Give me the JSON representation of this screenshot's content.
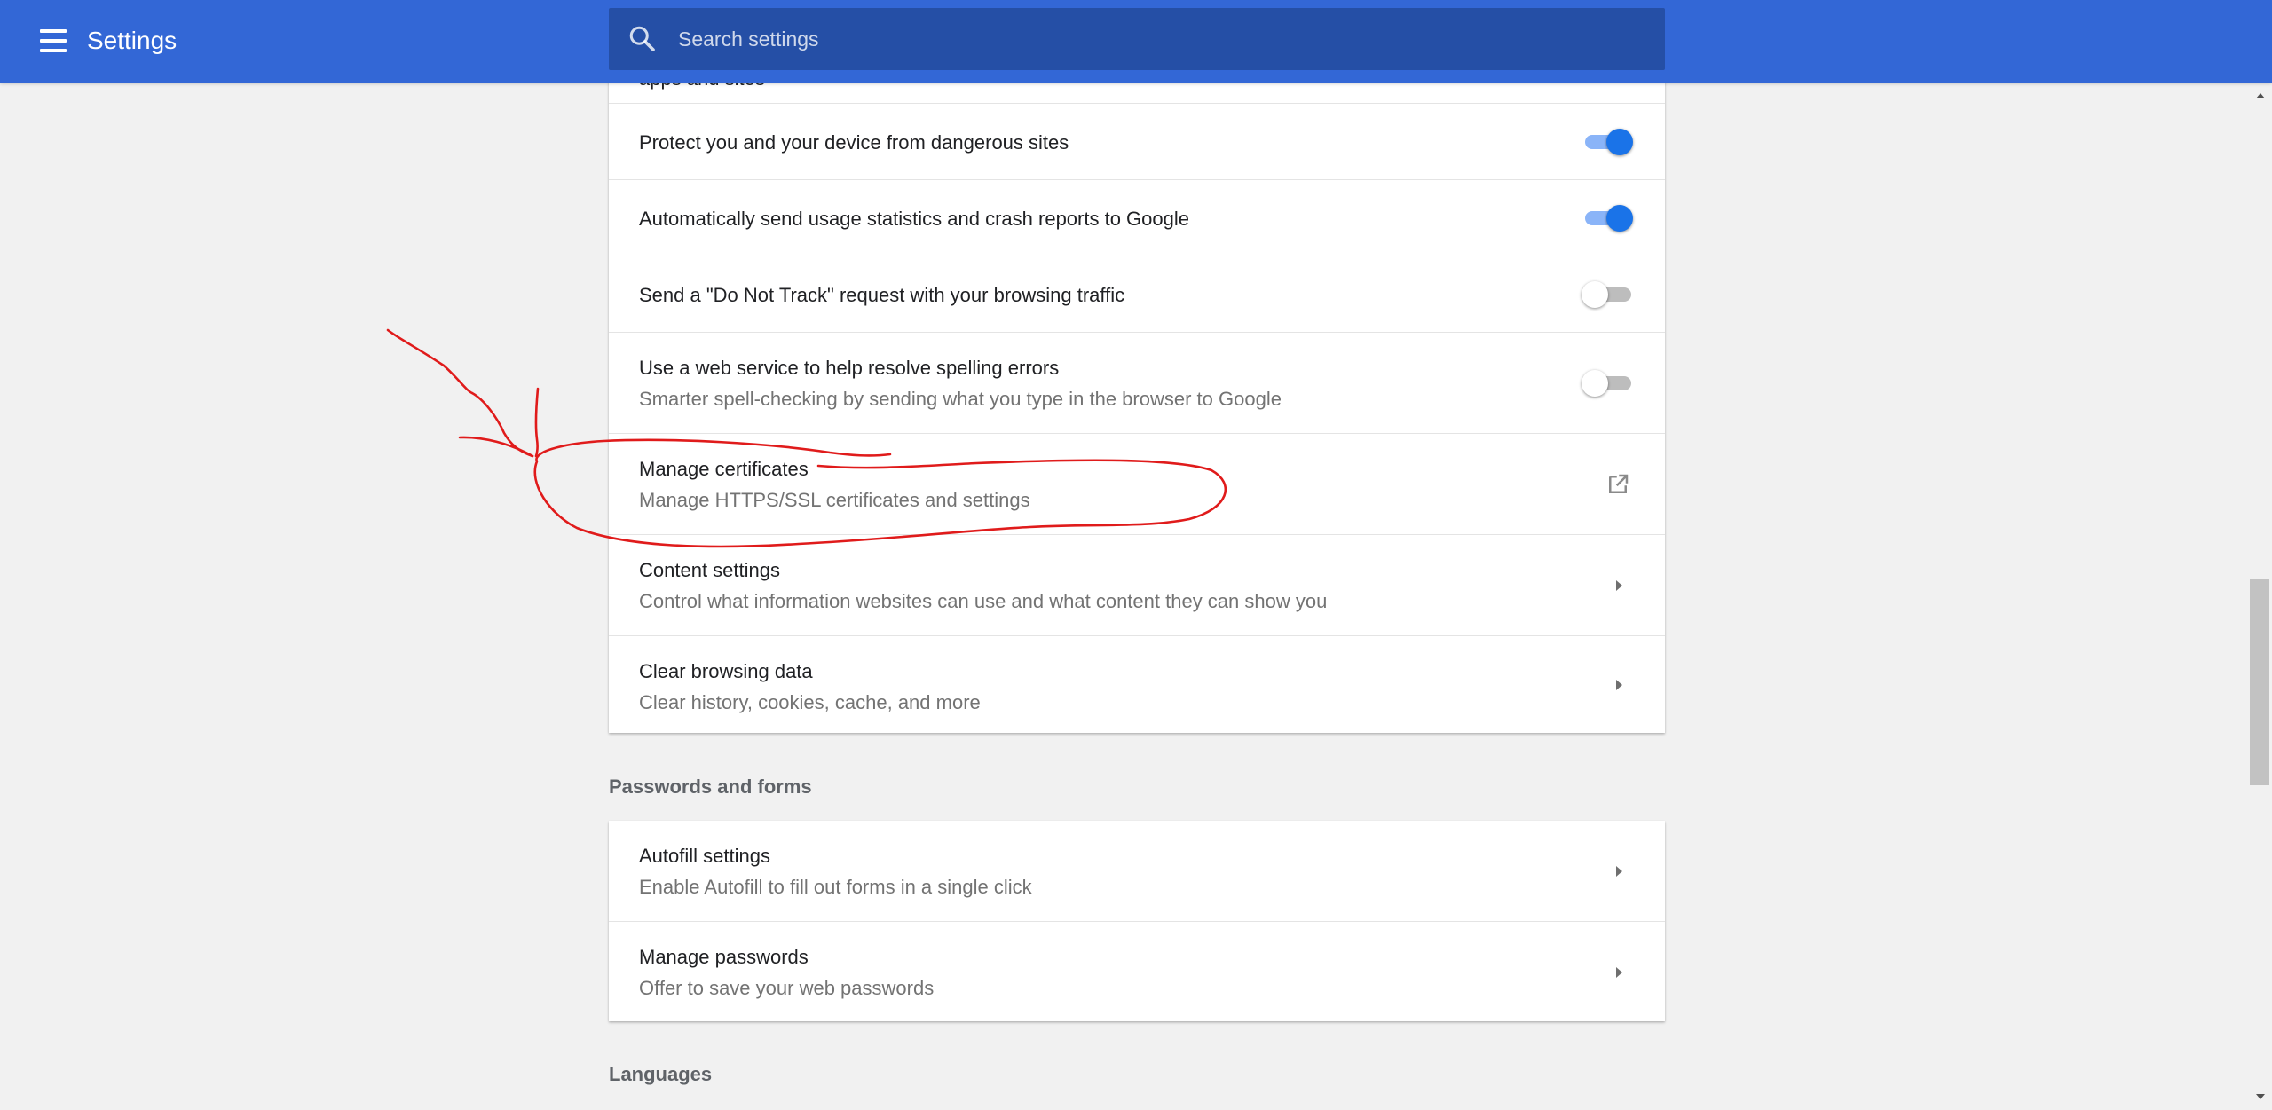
{
  "header": {
    "title": "Settings",
    "menu_icon": "hamburger-menu-icon",
    "search_icon": "search-icon",
    "search_placeholder": "Search settings",
    "bar_color": "#3367d6",
    "search_bg": "#254fa6"
  },
  "privacy": {
    "partial_row": {
      "label": "apps and sites"
    },
    "rows": [
      {
        "label": "Protect you and your device from dangerous sites",
        "toggle": "on"
      },
      {
        "label": "Automatically send usage statistics and crash reports to Google",
        "toggle": "on"
      },
      {
        "label": "Send a \"Do Not Track\" request with your browsing traffic",
        "toggle": "off"
      },
      {
        "label": "Use a web service to help resolve spelling errors",
        "sublabel": "Smarter spell-checking by sending what you type in the browser to Google",
        "toggle": "off"
      },
      {
        "label": "Manage certificates",
        "sublabel": "Manage HTTPS/SSL certificates and settings",
        "icon": "open-in-new-icon"
      },
      {
        "label": "Content settings",
        "sublabel": "Control what information websites can use and what content they can show you",
        "icon": "arrow-right-icon"
      },
      {
        "label": "Clear browsing data",
        "sublabel": "Clear history, cookies, cache, and more",
        "icon": "arrow-right-icon"
      }
    ]
  },
  "passwords": {
    "title": "Passwords and forms",
    "rows": [
      {
        "label": "Autofill settings",
        "sublabel": "Enable Autofill to fill out forms in a single click",
        "icon": "arrow-right-icon"
      },
      {
        "label": "Manage passwords",
        "sublabel": "Offer to save your web passwords",
        "icon": "arrow-right-icon"
      }
    ]
  },
  "languages": {
    "title": "Languages"
  },
  "annotation": {
    "color": "#e01b1b",
    "shape": "hand-drawn arrow and circle around Manage certificates"
  },
  "colors": {
    "toggle_on": "#1a73e8",
    "toggle_on_track": "#8ab4f8",
    "toggle_off_track": "#bdbdbd",
    "page_bg": "#f1f1f1"
  }
}
